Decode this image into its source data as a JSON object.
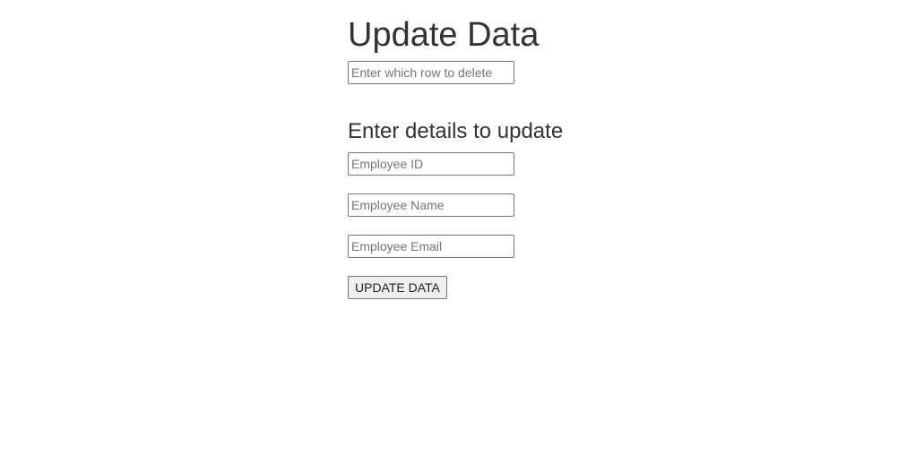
{
  "page": {
    "title": "Update Data"
  },
  "delete_row": {
    "placeholder": "Enter which row to delete",
    "value": ""
  },
  "update_section": {
    "title": "Enter details to update",
    "fields": {
      "employee_id": {
        "placeholder": "Employee ID",
        "value": ""
      },
      "employee_name": {
        "placeholder": "Employee Name",
        "value": ""
      },
      "employee_email": {
        "placeholder": "Employee Email",
        "value": ""
      }
    },
    "submit_label": "UPDATE DATA"
  }
}
